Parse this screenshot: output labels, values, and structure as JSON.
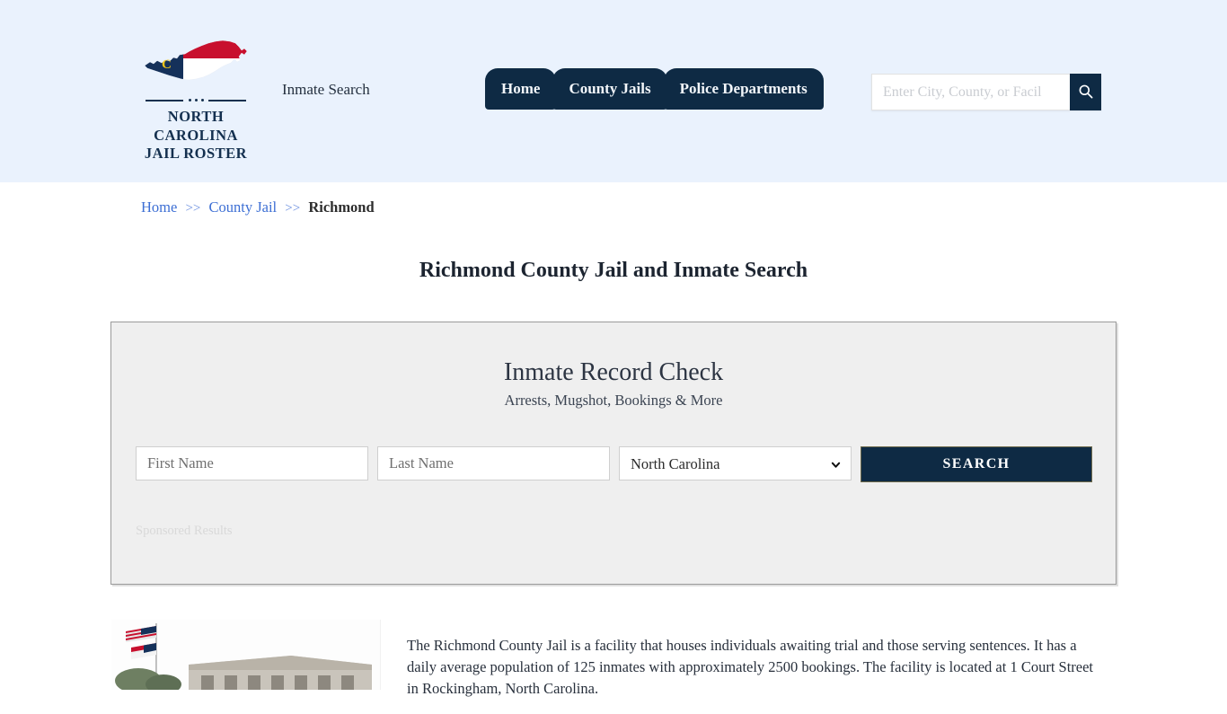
{
  "header": {
    "logo": {
      "icon": "north-carolina-state-map-icon",
      "line1": "NORTH CAROLINA",
      "line2": "JAIL ROSTER"
    },
    "tagline": "Inmate Search",
    "nav": [
      {
        "label": "Home"
      },
      {
        "label": "County Jails"
      },
      {
        "label": "Police Departments"
      }
    ],
    "search": {
      "placeholder": "Enter City, County, or Facil",
      "value": "",
      "button_icon": "search-icon"
    },
    "background_color": "#eaf2fd",
    "accent_color": "#0e2a44"
  },
  "breadcrumb": {
    "items": [
      {
        "label": "Home",
        "link": true
      },
      {
        "label": "County Jail",
        "link": true
      },
      {
        "label": "Richmond",
        "link": false
      }
    ],
    "separator": ">>"
  },
  "page": {
    "title": "Richmond County Jail and Inmate Search"
  },
  "record_check": {
    "title": "Inmate Record Check",
    "subtitle": "Arrests, Mugshot, Bookings & More",
    "first_name": {
      "placeholder": "First Name",
      "value": ""
    },
    "last_name": {
      "placeholder": "Last Name",
      "value": ""
    },
    "state_select": {
      "selected": "North Carolina",
      "options": [
        "North Carolina"
      ]
    },
    "search_button": "SEARCH",
    "sponsored_label": "Sponsored Results"
  },
  "content": {
    "photo_alt": "richmond-county-jail-photo",
    "paragraph": "The Richmond County Jail is a facility that houses individuals awaiting trial and those serving sentences. It has a daily average population of 125 inmates with approximately 2500 bookings. The facility is located at 1 Court Street in Rockingham, North Carolina."
  }
}
